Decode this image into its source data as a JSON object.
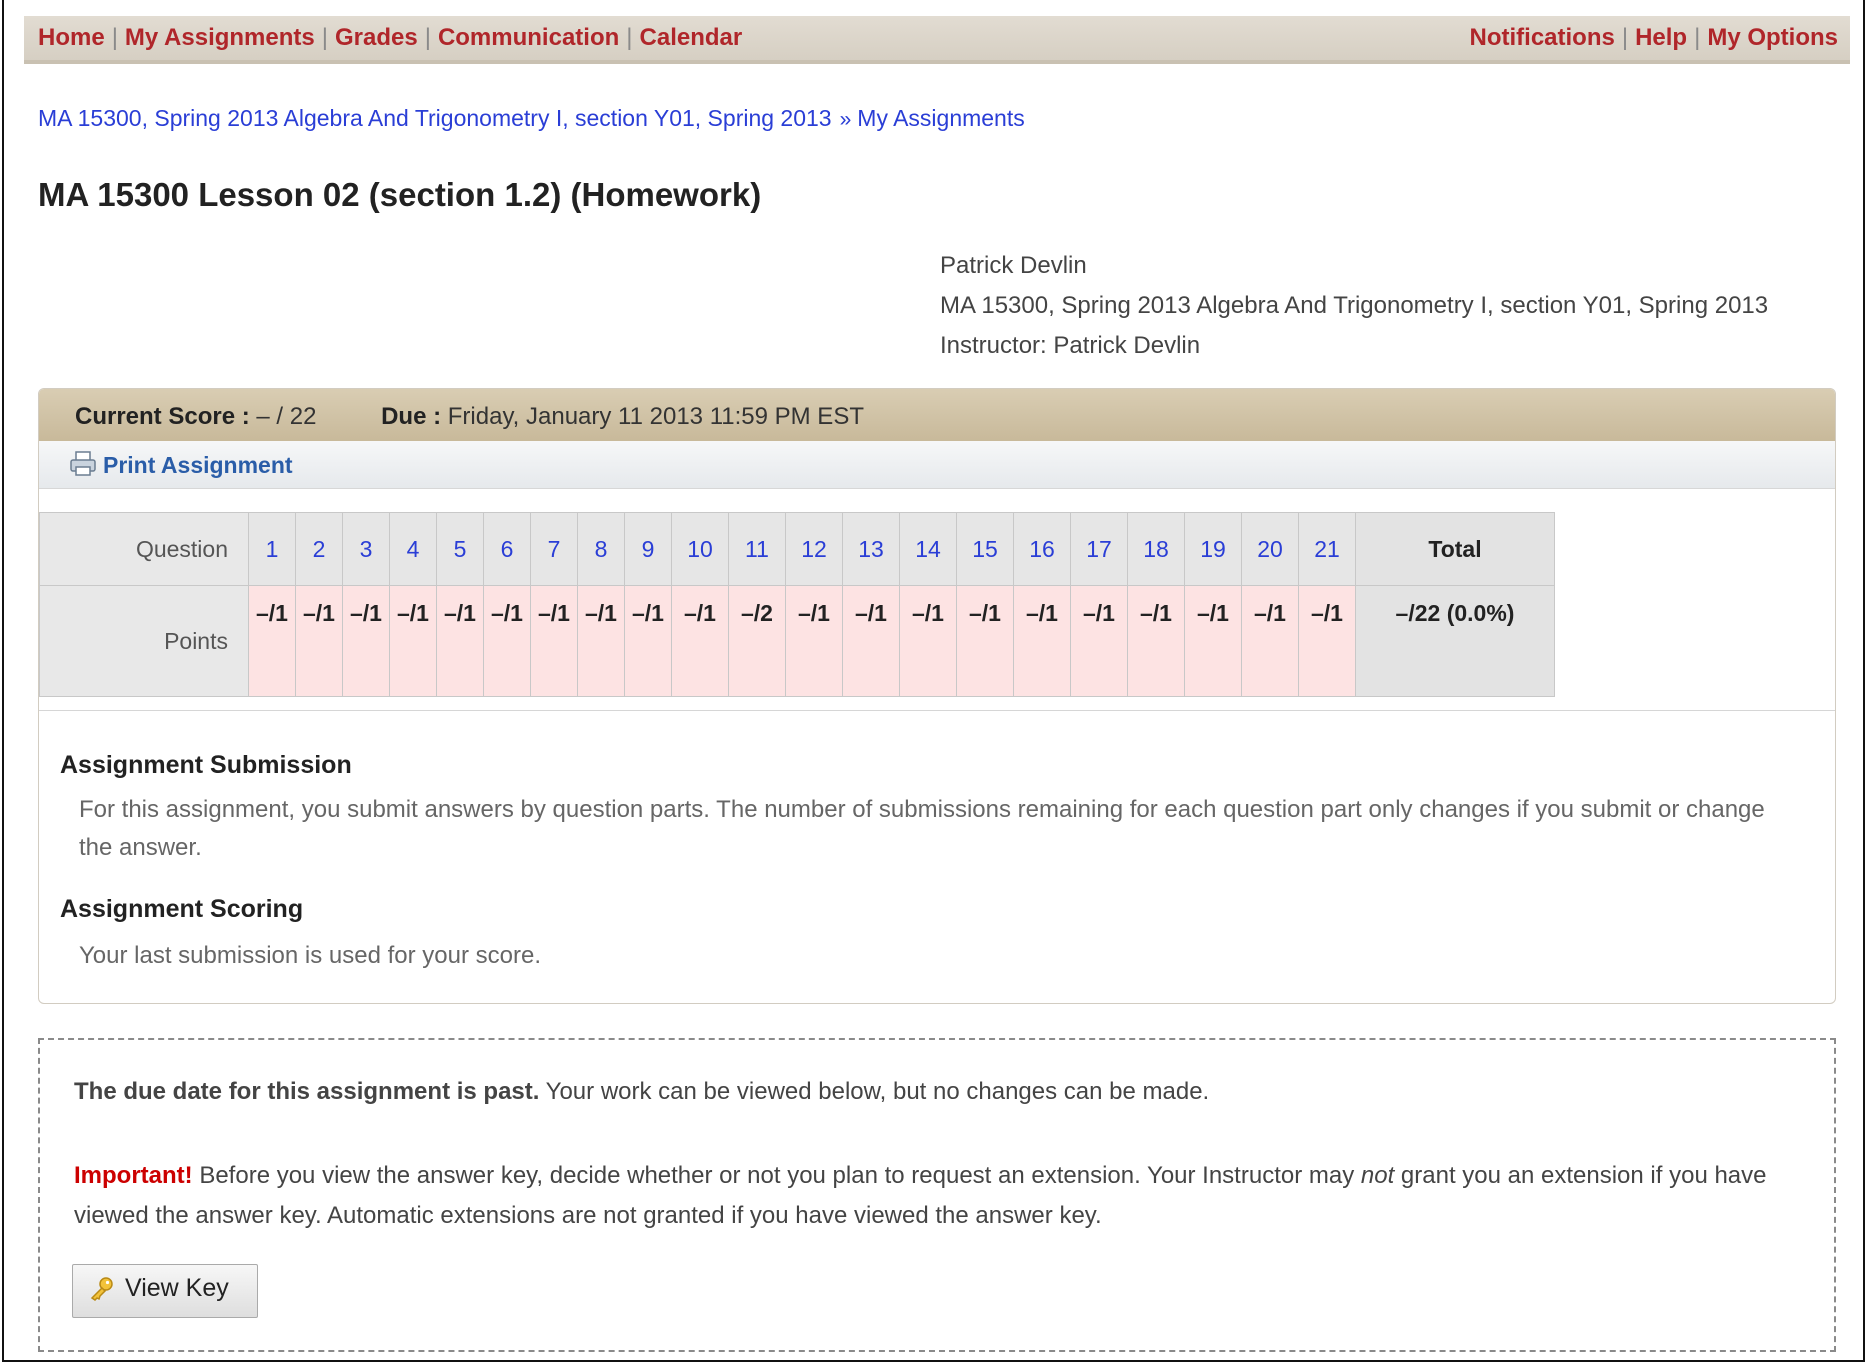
{
  "nav": {
    "left_items": [
      "Home",
      "My Assignments",
      "Grades",
      "Communication",
      "Calendar"
    ],
    "right_items": [
      "Notifications",
      "Help",
      "My Options"
    ]
  },
  "breadcrumb": {
    "course": "MA 15300, Spring 2013 Algebra And Trigonometry I, section Y01, Spring 2013",
    "current": "My Assignments"
  },
  "page_title": "MA 15300 Lesson 02 (section 1.2) (Homework)",
  "student_info": {
    "name": "Patrick Devlin",
    "course": "MA 15300, Spring 2013 Algebra And Trigonometry I, section Y01, Spring 2013",
    "instructor": "Instructor: Patrick Devlin"
  },
  "score_header": {
    "current_score_label": "Current Score :",
    "current_score_value": "– / 22",
    "due_label": "Due :",
    "due_value": "Friday, January 11 2013 11:59 PM EST"
  },
  "print_label": "Print Assignment",
  "score_table": {
    "question_label": "Question",
    "points_label": "Points",
    "total_label": "Total",
    "questions": [
      "1",
      "2",
      "3",
      "4",
      "5",
      "6",
      "7",
      "8",
      "9",
      "10",
      "11",
      "12",
      "13",
      "14",
      "15",
      "16",
      "17",
      "18",
      "19",
      "20",
      "21"
    ],
    "points": [
      "–/1",
      "–/1",
      "–/1",
      "–/1",
      "–/1",
      "–/1",
      "–/1",
      "–/1",
      "–/1",
      "–/1",
      "–/2",
      "–/1",
      "–/1",
      "–/1",
      "–/1",
      "–/1",
      "–/1",
      "–/1",
      "–/1",
      "–/1",
      "–/1"
    ],
    "total_points": "–/22 (0.0%)"
  },
  "submission": {
    "title": "Assignment Submission",
    "text": "For this assignment, you submit answers by question parts. The number of submissions remaining for each question part only changes if you submit or change the answer."
  },
  "scoring": {
    "title": "Assignment Scoring",
    "text": "Your last submission is used for your score."
  },
  "notice": {
    "due_bold": "The due date for this assignment is past.",
    "due_rest": " Your work can be viewed below, but no changes can be made.",
    "important_label": "Important!",
    "important_text_1": " Before you view the answer key, decide whether or not you plan to request an extension. Your Instructor may ",
    "important_em": "not",
    "important_text_2": " grant you an extension if you have viewed the answer key. Automatic extensions are not granted if you have viewed the answer key.",
    "view_key_label": "View Key"
  }
}
